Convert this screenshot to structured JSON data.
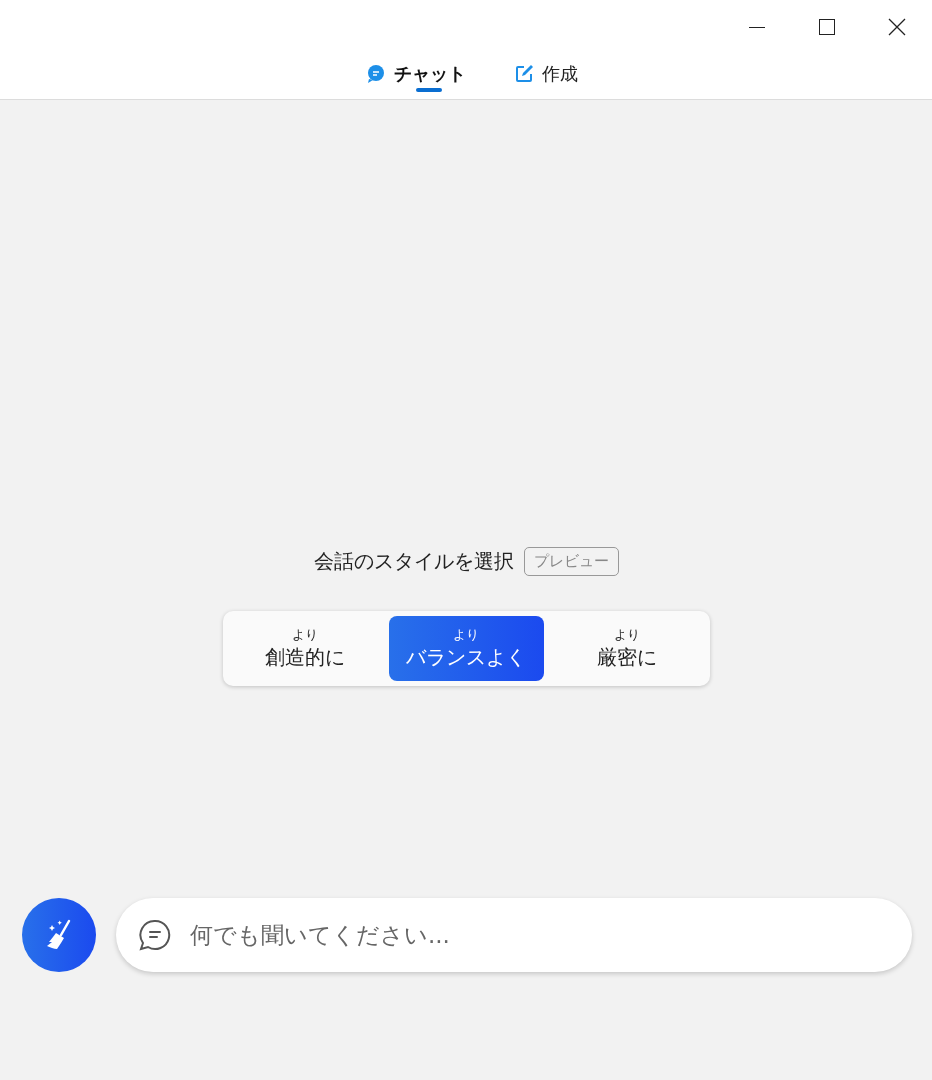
{
  "tabs": [
    {
      "label": "チャット",
      "kind": "chat",
      "selected": true
    },
    {
      "label": "作成",
      "kind": "compose",
      "selected": false
    }
  ],
  "style_picker": {
    "title": "会話のスタイルを選択",
    "badge": "プレビュー",
    "options": [
      {
        "prefix": "より",
        "label": "創造的に",
        "selected": false
      },
      {
        "prefix": "より",
        "label": "バランスよく",
        "selected": true
      },
      {
        "prefix": "より",
        "label": "厳密に",
        "selected": false
      }
    ]
  },
  "input": {
    "placeholder": "何でも聞いてください..."
  }
}
